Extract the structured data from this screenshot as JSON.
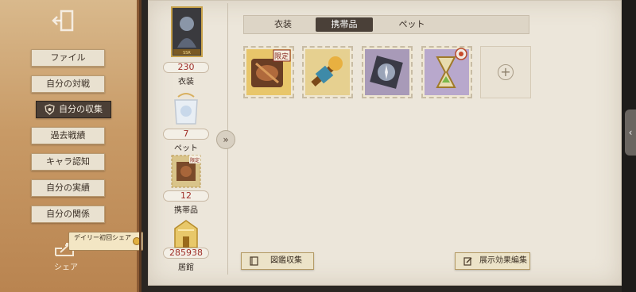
{
  "sidebar": {
    "items": [
      {
        "label": "ファイル"
      },
      {
        "label": "自分の対戦"
      },
      {
        "label": "自分の収集"
      },
      {
        "label": "過去戦績"
      },
      {
        "label": "キャラ認知"
      },
      {
        "label": "自分の実績"
      },
      {
        "label": "自分の関係"
      }
    ],
    "active_index": 2,
    "share_label": "シェア",
    "daily_tip": "デイリー初回シェア"
  },
  "stats": {
    "costume": {
      "value": "230",
      "label": "衣装",
      "badge": "SSR"
    },
    "pet": {
      "value": "7",
      "label": "ペット"
    },
    "carry": {
      "value": "12",
      "label": "携帯品",
      "badge": "限定"
    },
    "residence": {
      "value": "285938",
      "label": "居館"
    }
  },
  "tabs": [
    {
      "label": "衣装"
    },
    {
      "label": "携帯品"
    },
    {
      "label": "ペット"
    }
  ],
  "active_tab": 1,
  "items": [
    {
      "name": "limited-drum-accessory",
      "badge": "限定"
    },
    {
      "name": "golden-lantern-accessory"
    },
    {
      "name": "silver-compass-accessory"
    },
    {
      "name": "hourglass-accessory",
      "badge": "new"
    }
  ],
  "buttons": {
    "collection": "図鑑収集",
    "edit_effect": "展示効果編集"
  },
  "colors": {
    "sidebar": "#c89a66",
    "paper": "#ece6da",
    "active_tab": "#4a4038",
    "stat_value": "#a0302a"
  }
}
